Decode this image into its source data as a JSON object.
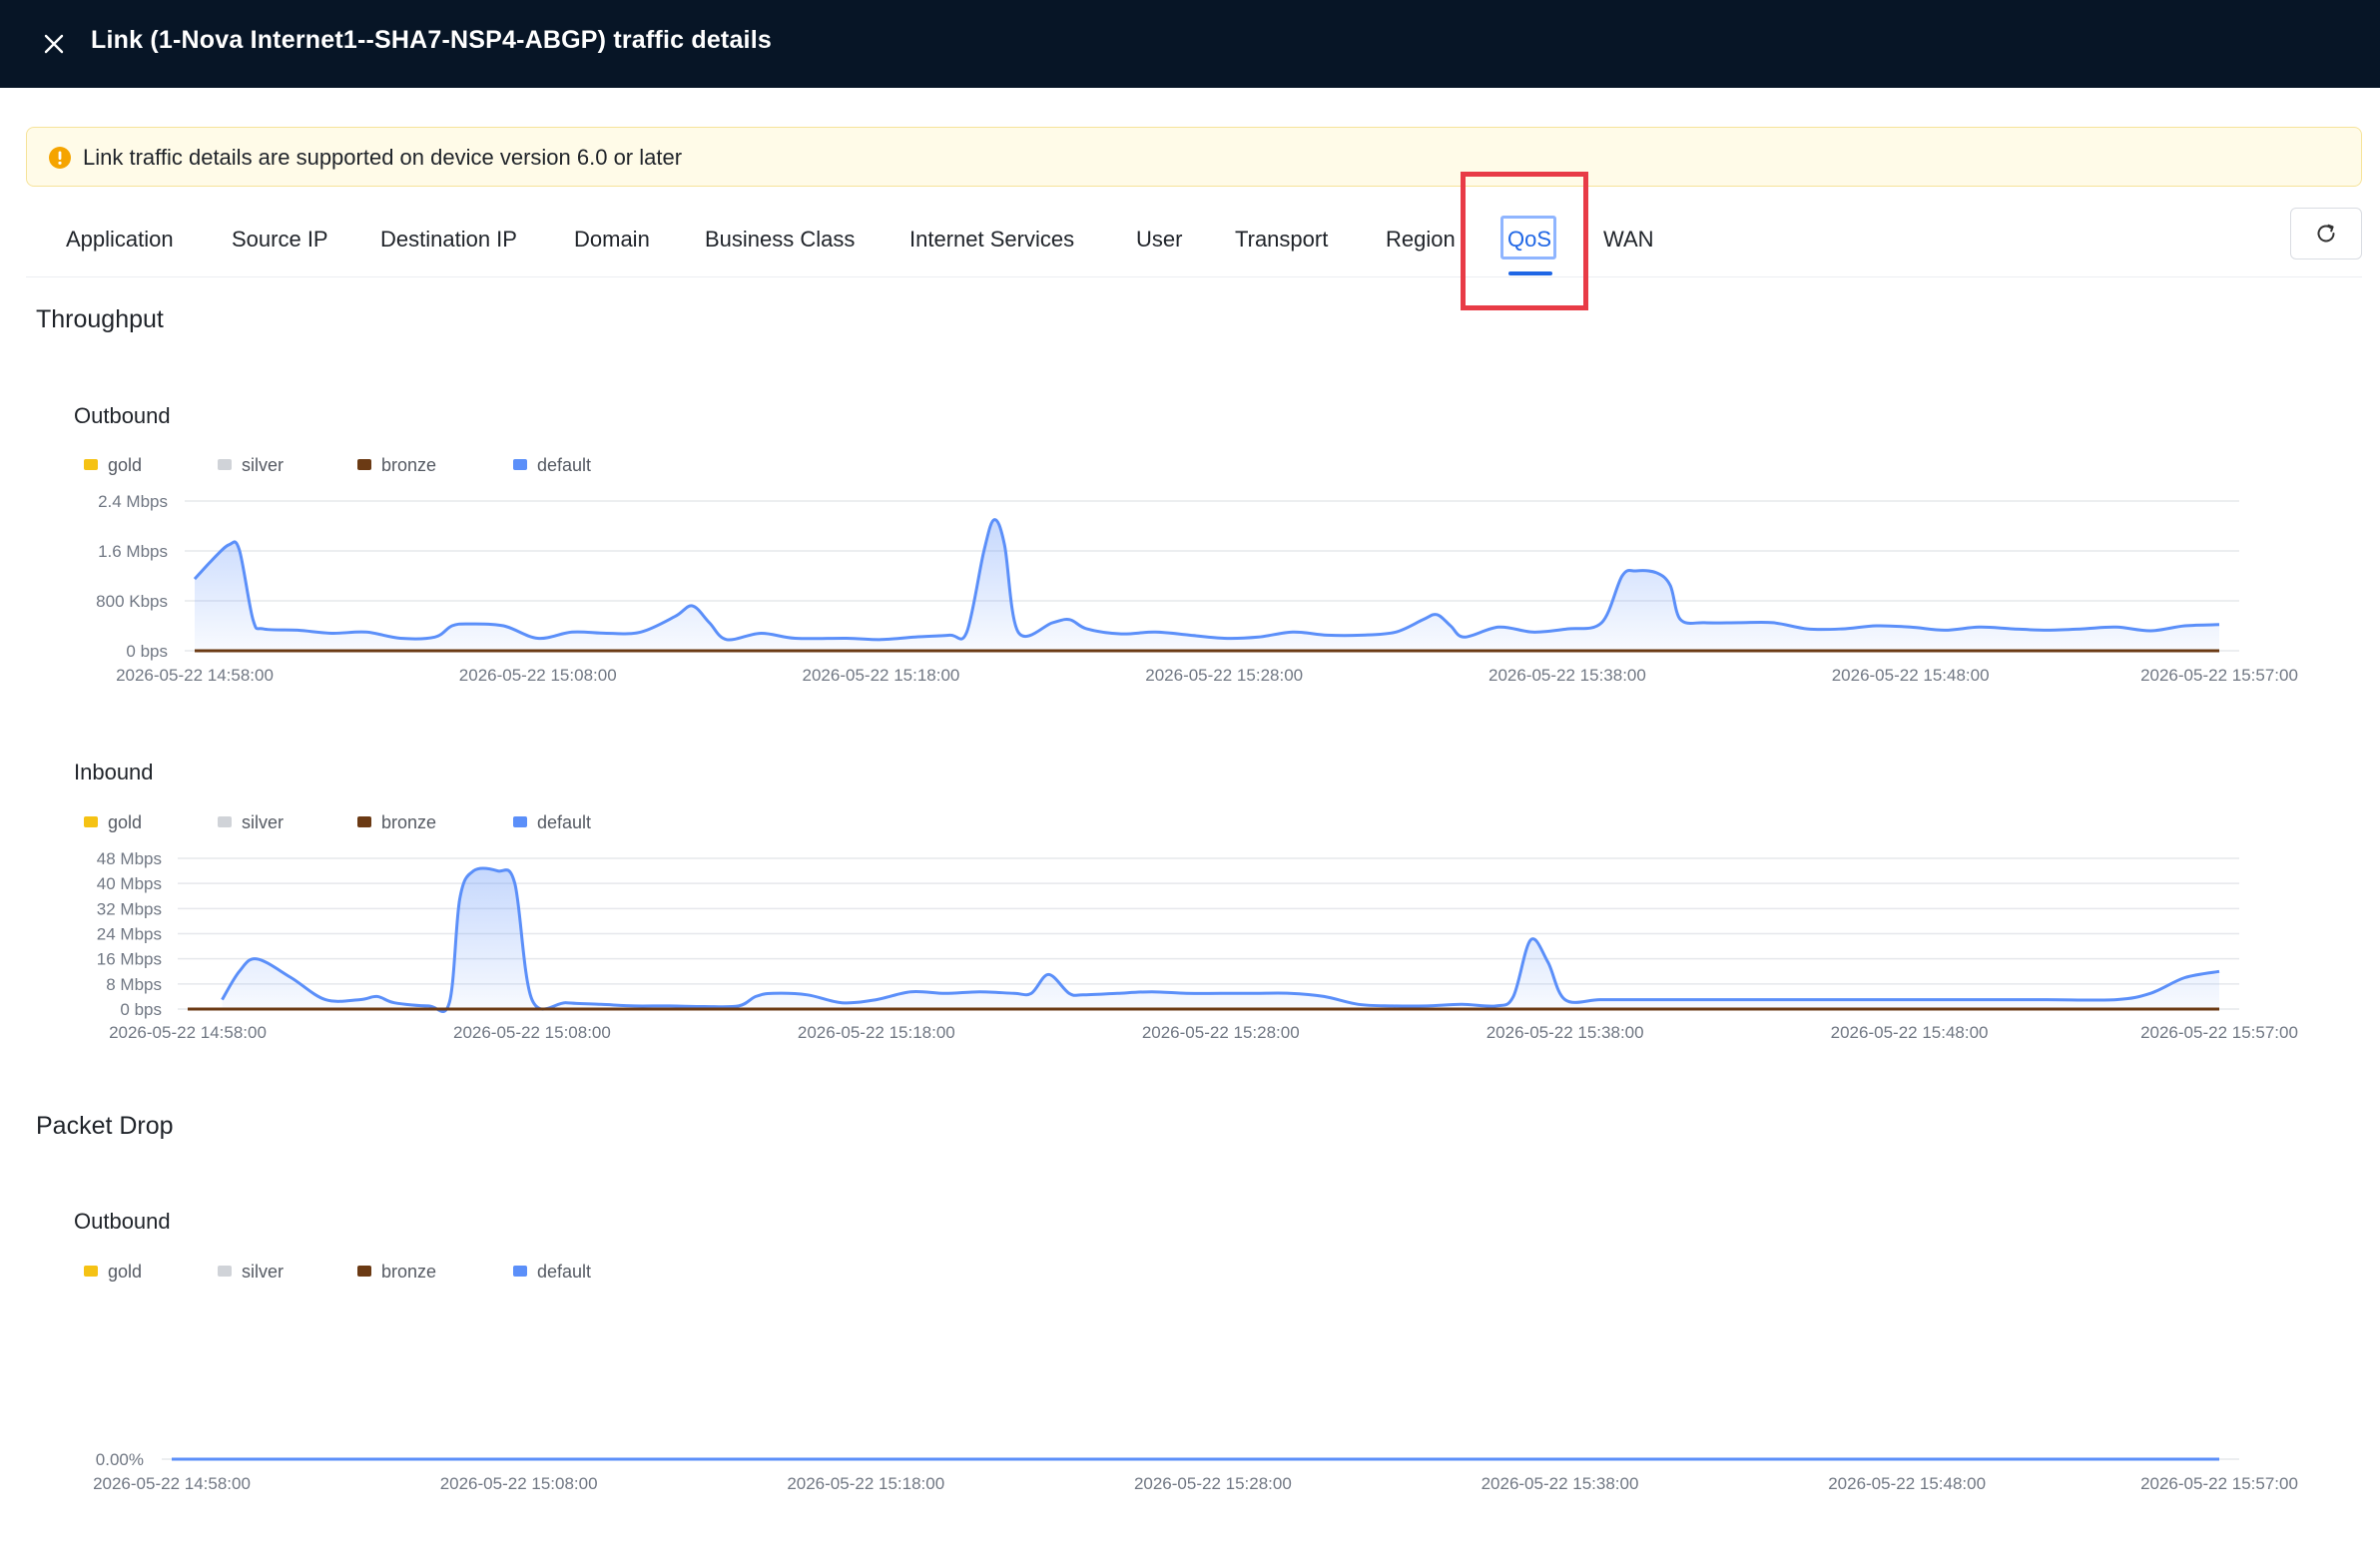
{
  "header": {
    "title": "Link (1-Nova Internet1--SHA7-NSP4-ABGP) traffic details",
    "close_icon": "close-icon"
  },
  "notice": {
    "text": "Link traffic details are supported on device version 6.0 or later",
    "icon": "warning-icon",
    "color": "#f5a400"
  },
  "tabs": [
    {
      "label": "Application"
    },
    {
      "label": "Source IP"
    },
    {
      "label": "Destination IP"
    },
    {
      "label": "Domain"
    },
    {
      "label": "Business Class"
    },
    {
      "label": "Internet Services"
    },
    {
      "label": "User"
    },
    {
      "label": "Transport"
    },
    {
      "label": "Region"
    },
    {
      "label": "QoS",
      "active": true
    },
    {
      "label": "WAN"
    }
  ],
  "toolbar": {
    "refresh_icon": "refresh-icon"
  },
  "colors": {
    "accent": "#1f66e5",
    "highlight_box": "#e83b46",
    "gold": "#f5c214",
    "silver": "#d0d3d8",
    "bronze": "#6b3a14",
    "default": "#5b8ff9"
  },
  "sections": {
    "throughput": "Throughput",
    "packet_drop": "Packet Drop"
  },
  "legend": [
    "gold",
    "silver",
    "bronze",
    "default"
  ],
  "chart_data": [
    {
      "type": "area",
      "section": "Throughput",
      "title": "Outbound",
      "unit": "Mbps",
      "ylim": [
        0,
        2.4
      ],
      "y_ticks": [
        "0 bps",
        "800 Kbps",
        "1.6 Mbps",
        "2.4 Mbps"
      ],
      "x_ticks": [
        "2026-05-22 14:58:00",
        "2026-05-22 15:08:00",
        "2026-05-22 15:18:00",
        "2026-05-22 15:28:00",
        "2026-05-22 15:38:00",
        "2026-05-22 15:48:00",
        "2026-05-22 15:57:00"
      ],
      "x_minutes": [
        0,
        10,
        20,
        30,
        40,
        50,
        59
      ],
      "grid": true,
      "legend_position": "top-left",
      "series": [
        {
          "name": "gold",
          "values": [
            [
              0,
              0
            ],
            [
              59,
              0
            ]
          ]
        },
        {
          "name": "silver",
          "values": [
            [
              0,
              0
            ],
            [
              59,
              0
            ]
          ]
        },
        {
          "name": "bronze",
          "values": [
            [
              0,
              0
            ],
            [
              59,
              0
            ]
          ]
        },
        {
          "name": "default",
          "values": [
            [
              0,
              1.15
            ],
            [
              0.5,
              1.45
            ],
            [
              1,
              1.7
            ],
            [
              1.3,
              1.62
            ],
            [
              1.7,
              0.5
            ],
            [
              2,
              0.35
            ],
            [
              3,
              0.33
            ],
            [
              4,
              0.28
            ],
            [
              5,
              0.3
            ],
            [
              6,
              0.2
            ],
            [
              7,
              0.22
            ],
            [
              7.5,
              0.4
            ],
            [
              8,
              0.43
            ],
            [
              9,
              0.4
            ],
            [
              10,
              0.2
            ],
            [
              11,
              0.3
            ],
            [
              12,
              0.28
            ],
            [
              13,
              0.3
            ],
            [
              14,
              0.55
            ],
            [
              14.5,
              0.72
            ],
            [
              15,
              0.45
            ],
            [
              15.5,
              0.18
            ],
            [
              16.5,
              0.28
            ],
            [
              17.5,
              0.2
            ],
            [
              19,
              0.2
            ],
            [
              20,
              0.18
            ],
            [
              21,
              0.22
            ],
            [
              22,
              0.25
            ],
            [
              22.5,
              0.3
            ],
            [
              23,
              1.6
            ],
            [
              23.3,
              2.1
            ],
            [
              23.6,
              1.7
            ],
            [
              24,
              0.3
            ],
            [
              25,
              0.45
            ],
            [
              25.5,
              0.5
            ],
            [
              26,
              0.35
            ],
            [
              27,
              0.27
            ],
            [
              28,
              0.3
            ],
            [
              29,
              0.25
            ],
            [
              30,
              0.2
            ],
            [
              31,
              0.22
            ],
            [
              32,
              0.3
            ],
            [
              33,
              0.25
            ],
            [
              34,
              0.25
            ],
            [
              35,
              0.3
            ],
            [
              35.8,
              0.5
            ],
            [
              36.2,
              0.58
            ],
            [
              36.6,
              0.4
            ],
            [
              37,
              0.22
            ],
            [
              38,
              0.38
            ],
            [
              39,
              0.3
            ],
            [
              40,
              0.35
            ],
            [
              41,
              0.45
            ],
            [
              41.6,
              1.2
            ],
            [
              42,
              1.28
            ],
            [
              42.6,
              1.25
            ],
            [
              43,
              1.05
            ],
            [
              43.3,
              0.5
            ],
            [
              44,
              0.45
            ],
            [
              45,
              0.45
            ],
            [
              46,
              0.45
            ],
            [
              47,
              0.35
            ],
            [
              48,
              0.35
            ],
            [
              49,
              0.4
            ],
            [
              50,
              0.38
            ],
            [
              51,
              0.33
            ],
            [
              52,
              0.38
            ],
            [
              53,
              0.35
            ],
            [
              54,
              0.33
            ],
            [
              55,
              0.35
            ],
            [
              56,
              0.38
            ],
            [
              57,
              0.32
            ],
            [
              58,
              0.4
            ],
            [
              59,
              0.42
            ]
          ]
        }
      ]
    },
    {
      "type": "area",
      "section": "Throughput",
      "title": "Inbound",
      "unit": "Mbps",
      "ylim": [
        0,
        48
      ],
      "y_ticks": [
        "0 bps",
        "8 Mbps",
        "16 Mbps",
        "24 Mbps",
        "32 Mbps",
        "40 Mbps",
        "48 Mbps"
      ],
      "x_ticks": [
        "2026-05-22 14:58:00",
        "2026-05-22 15:08:00",
        "2026-05-22 15:18:00",
        "2026-05-22 15:28:00",
        "2026-05-22 15:38:00",
        "2026-05-22 15:48:00",
        "2026-05-22 15:57:00"
      ],
      "x_minutes": [
        0,
        10,
        20,
        30,
        40,
        50,
        59
      ],
      "grid": true,
      "legend_position": "top-left",
      "series": [
        {
          "name": "gold",
          "values": [
            [
              0,
              0
            ],
            [
              59,
              0
            ]
          ]
        },
        {
          "name": "silver",
          "values": [
            [
              0,
              0
            ],
            [
              59,
              0
            ]
          ]
        },
        {
          "name": "bronze",
          "values": [
            [
              0,
              0
            ],
            [
              59,
              0
            ]
          ]
        },
        {
          "name": "default",
          "values": [
            [
              1,
              3
            ],
            [
              1.5,
              12
            ],
            [
              2,
              16
            ],
            [
              3,
              10
            ],
            [
              4,
              3
            ],
            [
              5,
              3
            ],
            [
              5.5,
              4
            ],
            [
              6,
              2
            ],
            [
              7,
              1
            ],
            [
              7.6,
              2
            ],
            [
              7.9,
              35
            ],
            [
              8.3,
              44
            ],
            [
              9,
              44
            ],
            [
              9.5,
              40
            ],
            [
              10,
              3
            ],
            [
              11,
              2
            ],
            [
              12,
              1.5
            ],
            [
              13,
              1
            ],
            [
              14,
              1
            ],
            [
              15,
              0.8
            ],
            [
              16,
              1
            ],
            [
              16.5,
              4
            ],
            [
              17,
              5
            ],
            [
              18,
              4.5
            ],
            [
              19,
              2
            ],
            [
              20,
              3
            ],
            [
              21,
              5.5
            ],
            [
              22,
              5
            ],
            [
              23,
              5.5
            ],
            [
              24,
              5
            ],
            [
              24.5,
              5
            ],
            [
              25,
              11
            ],
            [
              25.6,
              5
            ],
            [
              26,
              4.5
            ],
            [
              27,
              5
            ],
            [
              28,
              5.5
            ],
            [
              29,
              5
            ],
            [
              30,
              5
            ],
            [
              31,
              5
            ],
            [
              32,
              5
            ],
            [
              33,
              4
            ],
            [
              34,
              1.5
            ],
            [
              35,
              1
            ],
            [
              36,
              1
            ],
            [
              37,
              1.5
            ],
            [
              38,
              1
            ],
            [
              38.5,
              4
            ],
            [
              39,
              22
            ],
            [
              39.5,
              15
            ],
            [
              40,
              3
            ],
            [
              41,
              3
            ],
            [
              42,
              3
            ],
            [
              43,
              3
            ],
            [
              44,
              3
            ],
            [
              46,
              3
            ],
            [
              48,
              3
            ],
            [
              50,
              3
            ],
            [
              52,
              3
            ],
            [
              54,
              3
            ],
            [
              56,
              3
            ],
            [
              57,
              5
            ],
            [
              58,
              10
            ],
            [
              59,
              12
            ]
          ]
        }
      ]
    },
    {
      "type": "area",
      "section": "Packet Drop",
      "title": "Outbound",
      "unit": "%",
      "ylim": [
        0,
        100
      ],
      "y_ticks": [
        "0.00%"
      ],
      "x_ticks": [
        "2026-05-22 14:58:00",
        "2026-05-22 15:08:00",
        "2026-05-22 15:18:00",
        "2026-05-22 15:28:00",
        "2026-05-22 15:38:00",
        "2026-05-22 15:48:00",
        "2026-05-22 15:57:00"
      ],
      "x_minutes": [
        0,
        10,
        20,
        30,
        40,
        50,
        59
      ],
      "grid": true,
      "legend_position": "top-left",
      "series": [
        {
          "name": "gold",
          "values": [
            [
              0,
              0
            ],
            [
              59,
              0
            ]
          ]
        },
        {
          "name": "silver",
          "values": [
            [
              0,
              0
            ],
            [
              59,
              0
            ]
          ]
        },
        {
          "name": "bronze",
          "values": [
            [
              0,
              0
            ],
            [
              59,
              0
            ]
          ]
        },
        {
          "name": "default",
          "values": [
            [
              0,
              0
            ],
            [
              59,
              0
            ]
          ]
        }
      ]
    }
  ]
}
